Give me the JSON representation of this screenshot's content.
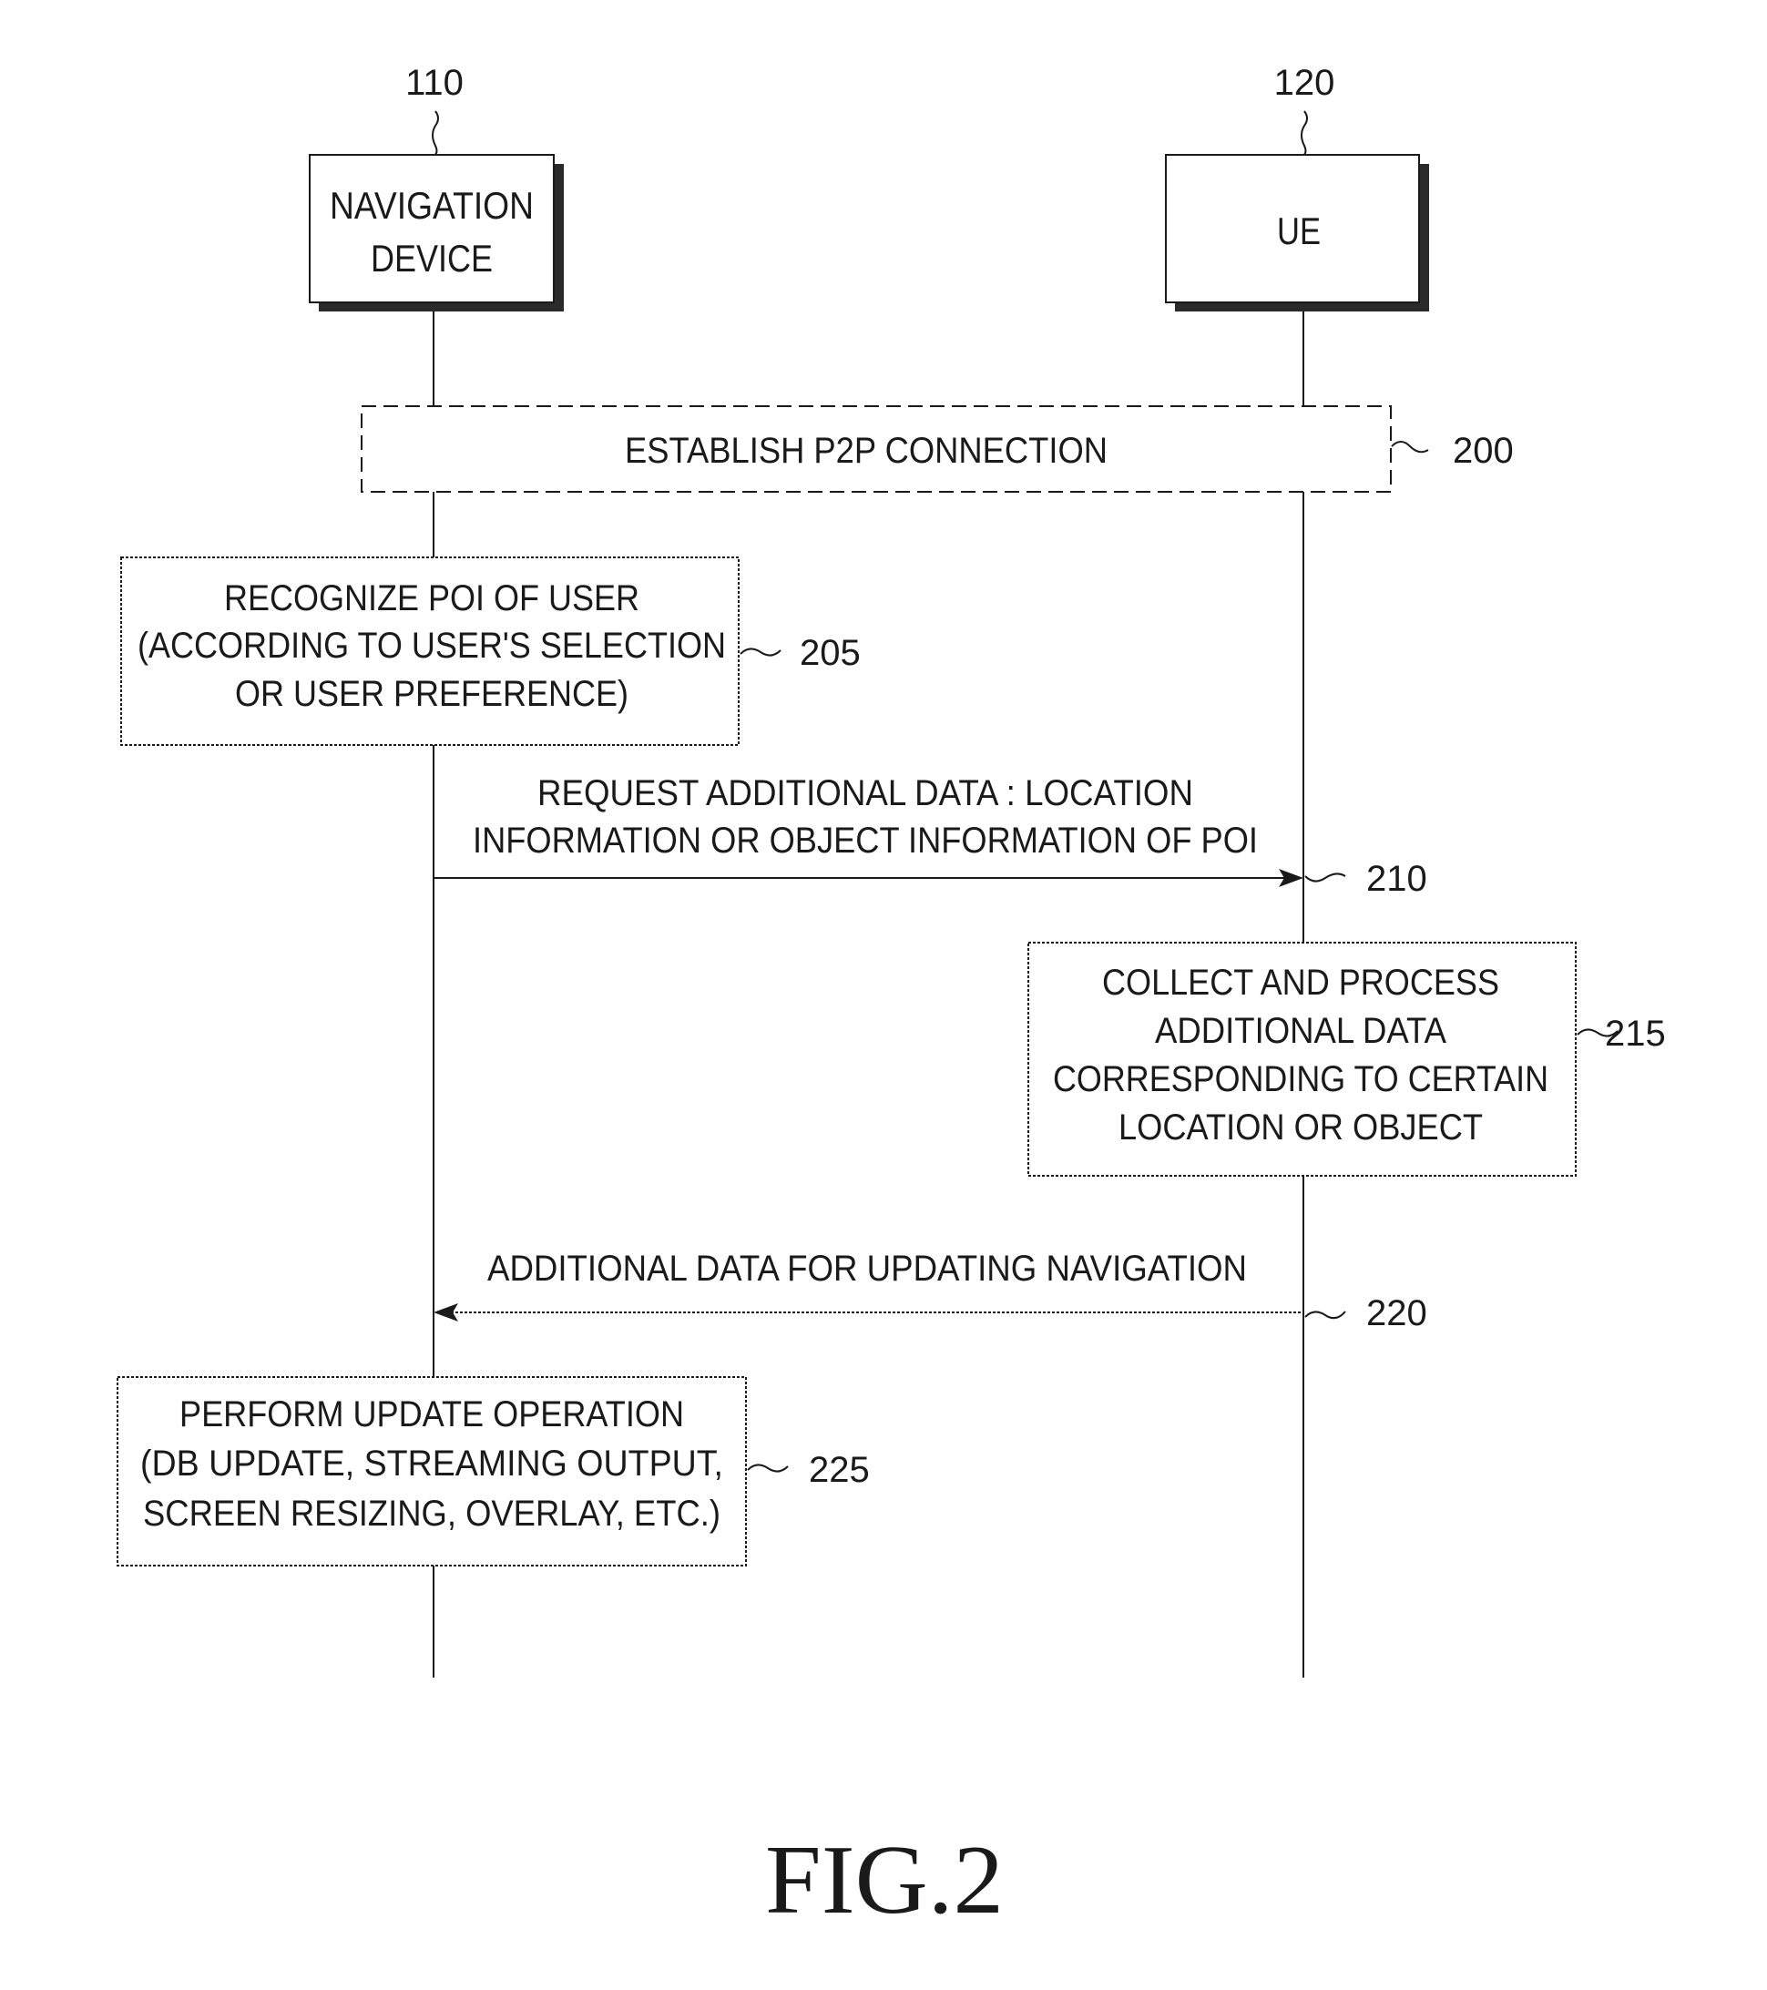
{
  "figure": {
    "caption": "FIG.2",
    "entities": [
      {
        "ref": "110",
        "label_lines": [
          "NAVIGATION",
          "DEVICE"
        ]
      },
      {
        "ref": "120",
        "label_lines": [
          "UE"
        ]
      }
    ],
    "steps": [
      {
        "ref": "200",
        "type": "spanning-box",
        "lines": [
          "ESTABLISH P2P CONNECTION"
        ]
      },
      {
        "ref": "205",
        "type": "process-box",
        "owner": "110",
        "lines": [
          "RECOGNIZE POI OF USER",
          "(ACCORDING TO USER'S SELECTION",
          "OR USER PREFERENCE)"
        ]
      },
      {
        "ref": "210",
        "type": "message",
        "from": "110",
        "to": "120",
        "lines": [
          "REQUEST ADDITIONAL DATA : LOCATION",
          "INFORMATION OR OBJECT INFORMATION OF POI"
        ]
      },
      {
        "ref": "215",
        "type": "process-box",
        "owner": "120",
        "lines": [
          "COLLECT AND PROCESS",
          "ADDITIONAL DATA",
          "CORRESPONDING TO CERTAIN",
          "LOCATION OR OBJECT"
        ]
      },
      {
        "ref": "220",
        "type": "message",
        "from": "120",
        "to": "110",
        "lines": [
          "ADDITIONAL DATA FOR UPDATING NAVIGATION"
        ]
      },
      {
        "ref": "225",
        "type": "process-box",
        "owner": "110",
        "lines": [
          "PERFORM UPDATE OPERATION",
          "(DB UPDATE, STREAMING OUTPUT,",
          "SCREEN RESIZING, OVERLAY, ETC.)"
        ]
      }
    ]
  }
}
